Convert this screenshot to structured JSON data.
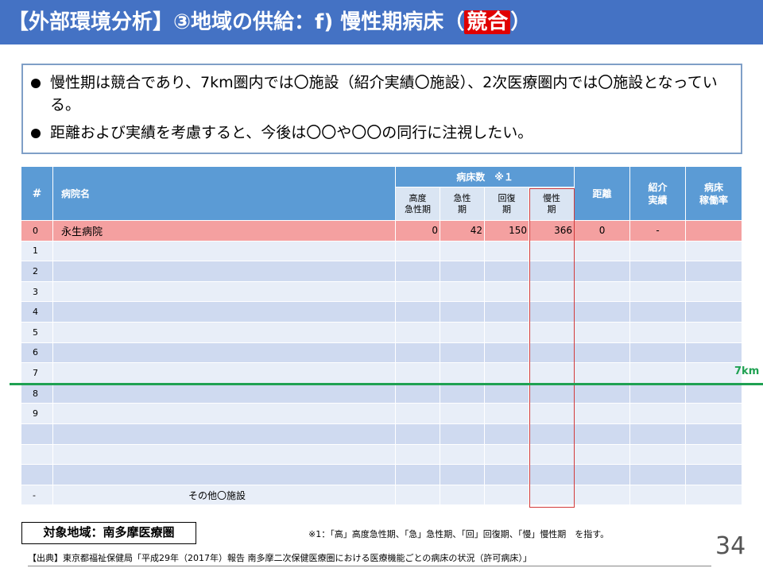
{
  "header": {
    "title_prefix": "【外部環境分析】③地域の供給：f) 慢性期病床（",
    "title_highlight": "競合",
    "title_suffix": "）"
  },
  "summary": {
    "bullet1": "慢性期は競合であり、7km圏内では〇施設（紹介実績〇施設）、2次医療圏内では〇施設となっている。",
    "bullet2": "距離および実績を考慮すると、今後は〇〇や〇〇の同行に注視したい。"
  },
  "table": {
    "headers": {
      "num": "#",
      "name": "病院名",
      "beds": "病床数　※１",
      "sub": [
        "高度\n急性期",
        "急性\n期",
        "回復\n期",
        "慢性\n期"
      ],
      "distance": "距離",
      "referral": "紹介\n実績",
      "occupancy": "病床\n稼働率"
    },
    "rows": [
      {
        "num": "0",
        "name": "永生病院",
        "acute_high": "0",
        "acute": "42",
        "recovery": "150",
        "chronic": "366",
        "distance": "0",
        "referral": "-",
        "occupancy": ""
      },
      {
        "num": "1",
        "name": "",
        "acute_high": "",
        "acute": "",
        "recovery": "",
        "chronic": "",
        "distance": "",
        "referral": "",
        "occupancy": ""
      },
      {
        "num": "2",
        "name": "",
        "acute_high": "",
        "acute": "",
        "recovery": "",
        "chronic": "",
        "distance": "",
        "referral": "",
        "occupancy": ""
      },
      {
        "num": "3",
        "name": "",
        "acute_high": "",
        "acute": "",
        "recovery": "",
        "chronic": "",
        "distance": "",
        "referral": "",
        "occupancy": ""
      },
      {
        "num": "4",
        "name": "",
        "acute_high": "",
        "acute": "",
        "recovery": "",
        "chronic": "",
        "distance": "",
        "referral": "",
        "occupancy": ""
      },
      {
        "num": "5",
        "name": "",
        "acute_high": "",
        "acute": "",
        "recovery": "",
        "chronic": "",
        "distance": "",
        "referral": "",
        "occupancy": ""
      },
      {
        "num": "6",
        "name": "",
        "acute_high": "",
        "acute": "",
        "recovery": "",
        "chronic": "",
        "distance": "",
        "referral": "",
        "occupancy": ""
      },
      {
        "num": "7",
        "name": "",
        "acute_high": "",
        "acute": "",
        "recovery": "",
        "chronic": "",
        "distance": "",
        "referral": "",
        "occupancy": ""
      },
      {
        "num": "8",
        "name": "",
        "acute_high": "",
        "acute": "",
        "recovery": "",
        "chronic": "",
        "distance": "",
        "referral": "",
        "occupancy": ""
      },
      {
        "num": "9",
        "name": "",
        "acute_high": "",
        "acute": "",
        "recovery": "",
        "chronic": "",
        "distance": "",
        "referral": "",
        "occupancy": ""
      },
      {
        "num": "",
        "name": "",
        "acute_high": "",
        "acute": "",
        "recovery": "",
        "chronic": "",
        "distance": "",
        "referral": "",
        "occupancy": ""
      },
      {
        "num": "",
        "name": "",
        "acute_high": "",
        "acute": "",
        "recovery": "",
        "chronic": "",
        "distance": "",
        "referral": "",
        "occupancy": ""
      },
      {
        "num": "",
        "name": "",
        "acute_high": "",
        "acute": "",
        "recovery": "",
        "chronic": "",
        "distance": "",
        "referral": "",
        "occupancy": ""
      }
    ],
    "other_row": {
      "num": "-",
      "name": "その他〇施設"
    }
  },
  "marker": {
    "label": "7km"
  },
  "footer": {
    "region": "対象地域：南多摩医療圏",
    "footnote": "※1：「高」高度急性期、「急」急性期、「回」回復期、「慢」慢性期　を指す。",
    "source": "【出典】東京都福祉保健局「平成29年（2017年）報告 南多摩二次保健医療圏における医療機能ごとの病床の状況（許可病床）」",
    "page": "34"
  },
  "colors": {
    "header_bg": "#4472c4",
    "highlight_red": "#e00000",
    "table_header": "#5b9bd5",
    "row_highlight": "#f4a0a0",
    "line_7km": "#1fa152",
    "chronic_frame": "#d23a3a"
  }
}
